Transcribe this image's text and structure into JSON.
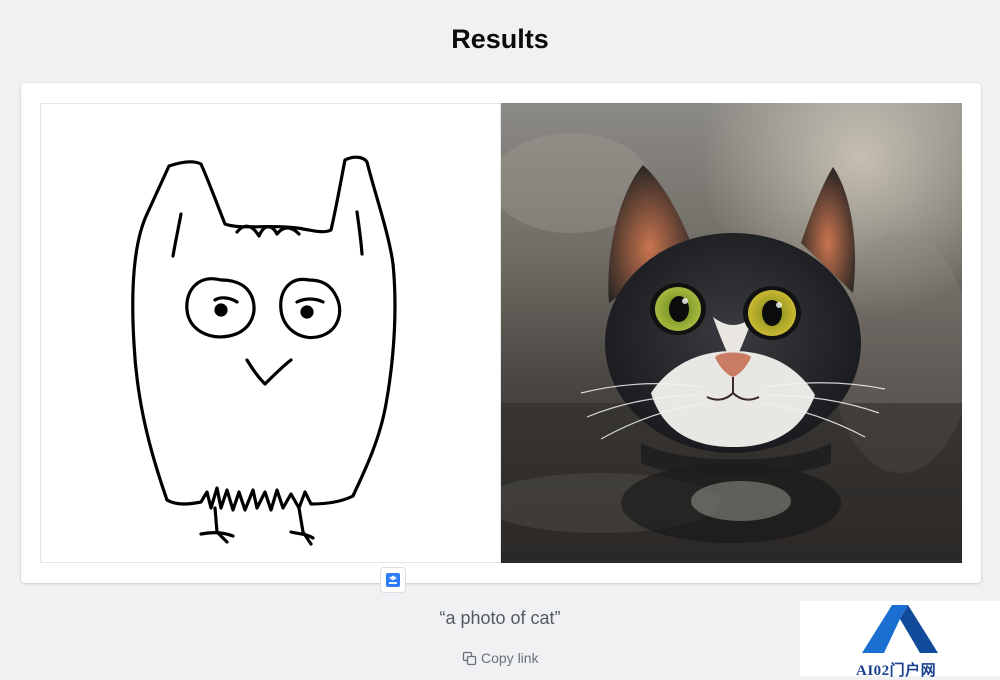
{
  "page": {
    "title": "Results"
  },
  "results": {
    "sketch_alt": "hand-drawn owl sketch",
    "photo_alt": "generated photo of cat"
  },
  "caption": {
    "prompt": "“a photo of cat”"
  },
  "actions": {
    "copy_link_label": "Copy link"
  },
  "badge": {
    "icon": "app-logo-icon"
  },
  "watermark": {
    "text": "AI02门户网"
  },
  "colors": {
    "background": "#f0f1f3",
    "card": "#ffffff",
    "title": "#0b0b0b",
    "caption": "#555a60",
    "link": "#6b7079",
    "watermark_blue": "#1a6fd1"
  }
}
